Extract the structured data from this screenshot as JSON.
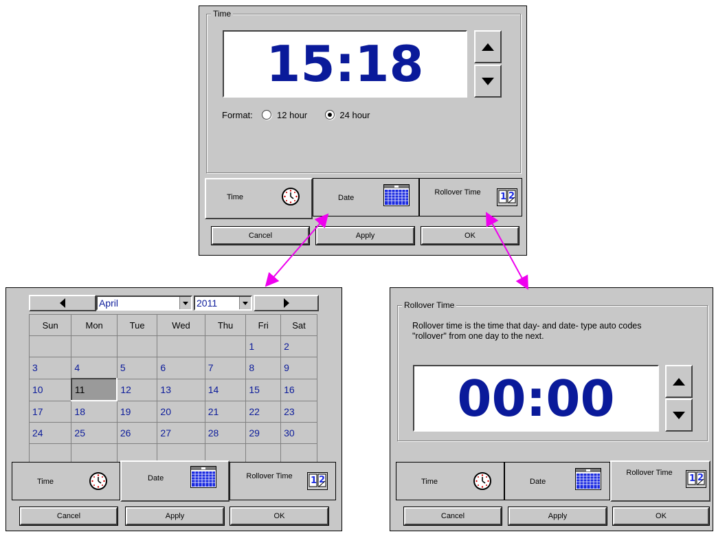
{
  "top_dialog": {
    "group_title": "Time",
    "time_value": "15:18",
    "format_label": "Format:",
    "option_12": "12 hour",
    "option_24": "24 hour",
    "selected_format": "24 hour"
  },
  "tabs": {
    "time": "Time",
    "date": "Date",
    "rollover": "Rollover Time"
  },
  "buttons": {
    "cancel": "Cancel",
    "apply": "Apply",
    "ok": "OK"
  },
  "date_dialog": {
    "month": "April",
    "year": "2011",
    "weekdays": [
      "Sun",
      "Mon",
      "Tue",
      "Wed",
      "Thu",
      "Fri",
      "Sat"
    ],
    "weeks": [
      [
        "",
        "",
        "",
        "",
        "",
        "1",
        "2"
      ],
      [
        "3",
        "4",
        "5",
        "6",
        "7",
        "8",
        "9"
      ],
      [
        "10",
        "11",
        "12",
        "13",
        "14",
        "15",
        "16"
      ],
      [
        "17",
        "18",
        "19",
        "20",
        "21",
        "22",
        "23"
      ],
      [
        "24",
        "25",
        "26",
        "27",
        "28",
        "29",
        "30"
      ],
      [
        "",
        "",
        "",
        "",
        "",
        "",
        ""
      ]
    ],
    "selected_day": "11"
  },
  "rollover_dialog": {
    "group_title": "Rollover Time",
    "description": "Rollover time is the time that day- and date- type auto codes \"rollover\" from one day to the next.",
    "time_value": "00:00"
  },
  "colors": {
    "panel": "#c8c8c8",
    "time_digits": "#0a1a9a",
    "arrow": "#ee00ee"
  },
  "icons": [
    "clock-icon",
    "calendar-icon",
    "rollover-icon",
    "up-arrow-icon",
    "down-arrow-icon",
    "left-arrow-icon",
    "right-arrow-icon",
    "dropdown-arrow-icon"
  ]
}
